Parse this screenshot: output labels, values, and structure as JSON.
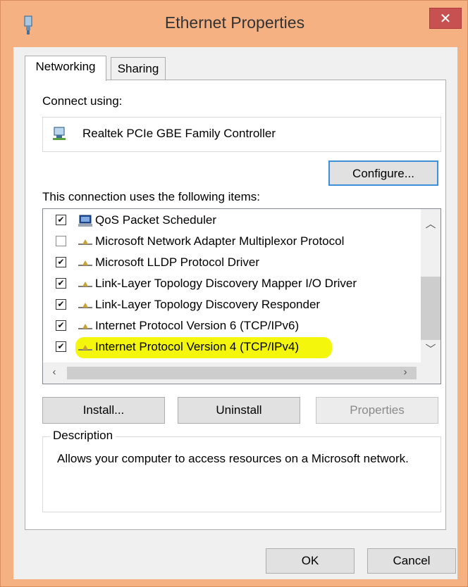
{
  "window": {
    "title": "Ethernet Properties",
    "close_label": "✕"
  },
  "tabs": [
    {
      "label": "Networking",
      "selected": true
    },
    {
      "label": "Sharing",
      "selected": false
    }
  ],
  "connect": {
    "label": "Connect using:",
    "adapter_name": "Realtek PCIe GBE Family Controller",
    "configure_label": "Configure..."
  },
  "items": {
    "label": "This connection uses the following items:",
    "list": [
      {
        "label": "QoS Packet Scheduler",
        "checked": true,
        "icon": "network-client-icon"
      },
      {
        "label": "Microsoft Network Adapter Multiplexor Protocol",
        "checked": false,
        "icon": "protocol-icon"
      },
      {
        "label": "Microsoft LLDP Protocol Driver",
        "checked": true,
        "icon": "protocol-icon"
      },
      {
        "label": "Link-Layer Topology Discovery Mapper I/O Driver",
        "checked": true,
        "icon": "protocol-icon"
      },
      {
        "label": "Link-Layer Topology Discovery Responder",
        "checked": true,
        "icon": "protocol-icon"
      },
      {
        "label": "Internet Protocol Version 6 (TCP/IPv6)",
        "checked": true,
        "icon": "protocol-icon"
      },
      {
        "label": "Internet Protocol Version 4 (TCP/IPv4)",
        "checked": true,
        "icon": "protocol-icon",
        "highlighted": true
      }
    ],
    "check_mark": "✔"
  },
  "buttons": {
    "install": "Install...",
    "uninstall": "Uninstall",
    "properties": "Properties",
    "ok": "OK",
    "cancel": "Cancel"
  },
  "description": {
    "legend": "Description",
    "text": "Allows your computer to access resources on a Microsoft network."
  },
  "colors": {
    "window_frame": "#f6b183",
    "close_button": "#c75050",
    "highlight": "#f4f70c",
    "focus_border": "#3c8fd8"
  }
}
